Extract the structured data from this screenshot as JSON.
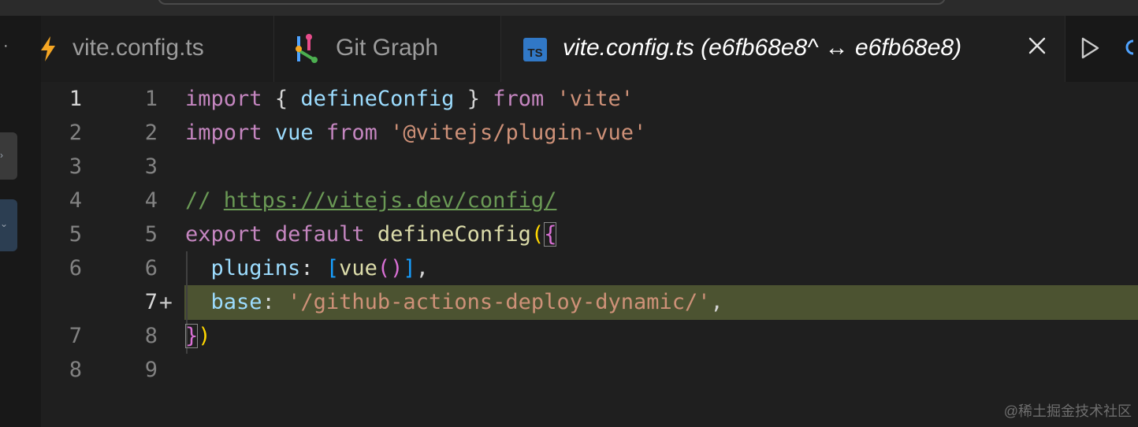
{
  "tabs": [
    {
      "label": "vite.config.ts",
      "icon": "lightning-icon",
      "icon_color": "#f5a623"
    },
    {
      "label": "Git Graph",
      "icon": "git-graph-icon"
    },
    {
      "label": "vite.config.ts (e6fb68e8^ ↔ e6fb68e8)",
      "icon": "typescript-icon",
      "icon_text": "TS",
      "icon_color": "#3178c6",
      "active": true
    }
  ],
  "editor": {
    "lines": [
      {
        "left": "1",
        "right": "1"
      },
      {
        "left": "2",
        "right": "2"
      },
      {
        "left": "3",
        "right": "3"
      },
      {
        "left": "4",
        "right": "4"
      },
      {
        "left": "5",
        "right": "5"
      },
      {
        "left": "6",
        "right": "6"
      },
      {
        "left": "",
        "right": "7",
        "added_marker": "+"
      },
      {
        "left": "7",
        "right": "8"
      },
      {
        "left": "8",
        "right": "9"
      }
    ],
    "code": {
      "l1": {
        "kw_import": "import",
        "open": "{",
        "ident": "defineConfig",
        "close": "}",
        "kw_from": "from",
        "str": "'vite'"
      },
      "l2": {
        "kw_import": "import",
        "ident": "vue",
        "kw_from": "from",
        "str": "'@vitejs/plugin-vue'"
      },
      "l4": {
        "slashes": "//",
        "url": "https://vitejs.dev/config/"
      },
      "l5": {
        "kw_export": "export",
        "kw_default": "default",
        "fn": "defineConfig",
        "paren": "(",
        "brace": "{"
      },
      "l6": {
        "prop": "plugins",
        "colon": ":",
        "bracket_open": "[",
        "fn": "vue",
        "paren_open": "(",
        "paren_close": ")",
        "bracket_close": "]",
        "comma": ","
      },
      "l7": {
        "prop": "base",
        "colon": ":",
        "str": "'/github-actions-deploy-dynamic/'",
        "comma": ","
      },
      "l8": {
        "brace": "}",
        "paren": ")"
      }
    },
    "highlight_color": "#4c5331"
  },
  "watermark": "@稀土掘金技术社区",
  "colors": {
    "keyword": "#c586c0",
    "variable": "#9cdcfe",
    "string": "#ce9178",
    "comment": "#6a9955",
    "function": "#dcdcaa"
  }
}
